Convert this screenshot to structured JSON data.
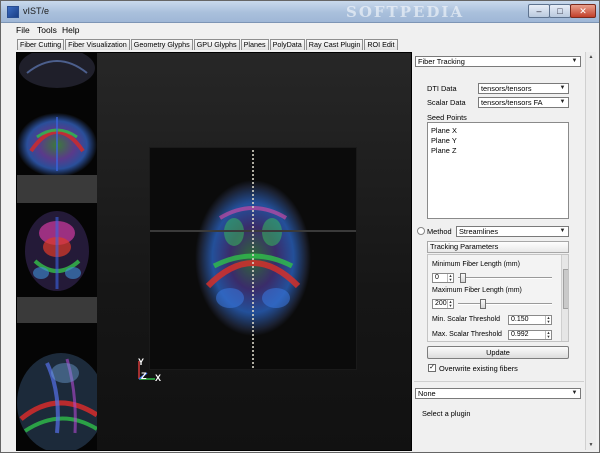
{
  "window": {
    "title": "vIST/e",
    "watermark": "SOFTPEDIA",
    "controls": {
      "minimize": "–",
      "maximize": "□",
      "close": "✕"
    }
  },
  "menu": {
    "file": "File",
    "tools": "Tools",
    "help": "Help"
  },
  "plugin_tabs": [
    "Fiber Cutting",
    "Fiber Visualization",
    "Geometry Glyphs",
    "GPU Glyphs",
    "Planes",
    "PolyData",
    "Ray Cast Plugin",
    "ROI Edit"
  ],
  "viewport": {
    "axis_labels": {
      "y": "Y",
      "z": "Z",
      "x": "X"
    }
  },
  "panel": {
    "plugin_select": "Fiber Tracking",
    "dti_data": {
      "label": "DTI Data",
      "value": "tensors/tensors"
    },
    "scalar_data": {
      "label": "Scalar Data",
      "value": "tensors/tensors FA"
    },
    "seed_points": {
      "label": "Seed Points",
      "items": [
        "Plane X",
        "Plane Y",
        "Plane Z"
      ]
    },
    "method": {
      "label": "Method",
      "value": "Streamlines"
    },
    "tracking_parameters": {
      "header": "Tracking Parameters",
      "min_fiber_length": {
        "label": "Minimum Fiber Length (mm)",
        "value": "0"
      },
      "max_fiber_length": {
        "label": "Maximum Fiber Length (mm)",
        "value": "200"
      },
      "min_scalar_threshold": {
        "label": "Min. Scalar Threshold",
        "value": "0.150"
      },
      "max_scalar_threshold": {
        "label": "Max. Scalar Threshold",
        "value": "0.992"
      }
    },
    "update_label": "Update",
    "overwrite": {
      "label": "Overwrite existing fibers",
      "checked": true,
      "mark": "✓"
    },
    "second_plugin_select": "None",
    "hint": "Select a plugin"
  },
  "icons": {
    "app": "vist-logo-icon",
    "dropdown": "chevron-down-icon",
    "spin": "spin-arrows-icon"
  },
  "colors": {
    "titlebar": "#a9c0dc",
    "viewport_bg": "#1a1a1a",
    "panel_bg": "#f0f0f0"
  }
}
